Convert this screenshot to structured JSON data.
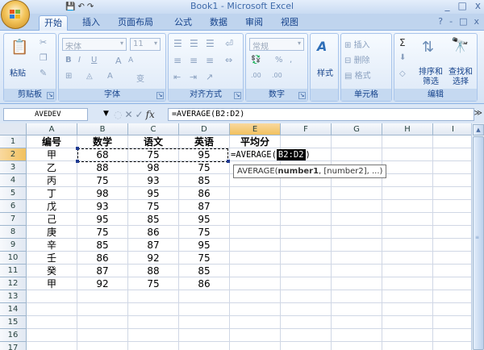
{
  "window": {
    "title": "Book1 - Microsoft Excel",
    "controls": [
      "_",
      "□",
      "x"
    ]
  },
  "qat": {
    "save": "💾",
    "undo": "↶",
    "redo": "↷"
  },
  "tabs": [
    {
      "label": "开始",
      "active": true
    },
    {
      "label": "插入"
    },
    {
      "label": "页面布局"
    },
    {
      "label": "公式"
    },
    {
      "label": "数据"
    },
    {
      "label": "审阅"
    },
    {
      "label": "视图"
    }
  ],
  "tabs_right": [
    "?",
    "-",
    "□",
    "x"
  ],
  "ribbon": {
    "clipboard": {
      "label": "剪贴板",
      "paste": "粘贴"
    },
    "font": {
      "label": "字体",
      "font_name": "宋体",
      "font_size": "11",
      "bold": "B",
      "italic": "I",
      "underline": "U",
      "grow": "A",
      "shrink": "A",
      "wen": "变"
    },
    "align": {
      "label": "对齐方式"
    },
    "number": {
      "label": "数字",
      "format": "常规",
      "percent": "%",
      "comma": ",",
      "dec_inc": ".00",
      "dec_dec": ".00"
    },
    "styles": {
      "label": "样式",
      "button": "样式"
    },
    "cells": {
      "label": "单元格",
      "insert": "插入",
      "delete": "删除",
      "format": "格式"
    },
    "editing": {
      "label": "编辑",
      "sort": "排序和",
      "filter": "筛选",
      "find": "查找和",
      "select": "选择",
      "sigma": "Σ"
    }
  },
  "formula_bar": {
    "name_box": "AVEDEV",
    "cancel": "✕",
    "enter": "✓",
    "fx": "fx",
    "formula": "=AVERAGE(B2:D2)"
  },
  "grid": {
    "columns": [
      "A",
      "B",
      "C",
      "D",
      "E",
      "F",
      "G",
      "H",
      "I"
    ],
    "rows": [
      "1",
      "2",
      "3",
      "4",
      "5",
      "6",
      "7",
      "8",
      "9",
      "10",
      "11",
      "12",
      "13",
      "14",
      "15",
      "16",
      "17"
    ],
    "header_row": [
      "编号",
      "数学",
      "语文",
      "英语",
      "平均分"
    ],
    "data": [
      [
        "甲",
        "68",
        "75",
        "95"
      ],
      [
        "乙",
        "88",
        "98",
        "75"
      ],
      [
        "丙",
        "75",
        "93",
        "85"
      ],
      [
        "丁",
        "98",
        "95",
        "86"
      ],
      [
        "戊",
        "93",
        "75",
        "87"
      ],
      [
        "己",
        "95",
        "85",
        "95"
      ],
      [
        "庚",
        "75",
        "86",
        "75"
      ],
      [
        "辛",
        "85",
        "87",
        "95"
      ],
      [
        "壬",
        "86",
        "92",
        "75"
      ],
      [
        "癸",
        "87",
        "88",
        "85"
      ],
      [
        "甲",
        "92",
        "75",
        "86"
      ]
    ],
    "editing_cell": {
      "prefix": "=AVERAGE(",
      "range": "B2:D2",
      "suffix": ")"
    },
    "tooltip": {
      "fn": "AVERAGE(",
      "arg1": "number1",
      "rest": ", [number2], ...)"
    }
  }
}
